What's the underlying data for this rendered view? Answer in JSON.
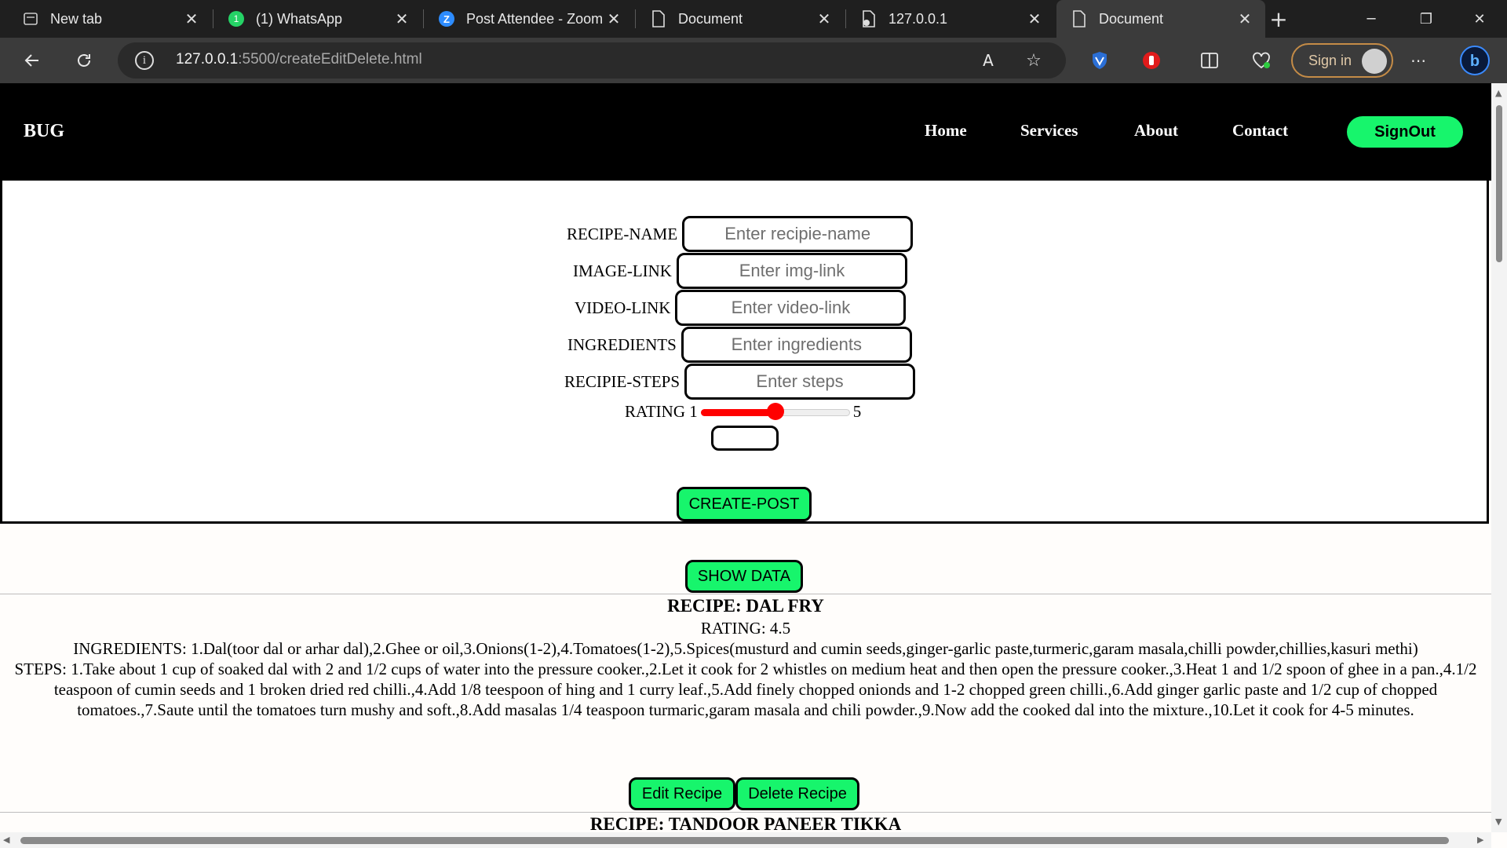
{
  "browser": {
    "tabs": [
      {
        "title": "New tab",
        "icon": "new-tab-icon",
        "active": false
      },
      {
        "title": "(1) WhatsApp",
        "icon": "whatsapp-icon",
        "active": false
      },
      {
        "title": "Post Attendee - Zoom",
        "icon": "zoom-icon",
        "active": false
      },
      {
        "title": "Document",
        "icon": "document-icon",
        "active": false
      },
      {
        "title": "127.0.0.1",
        "icon": "page-icon",
        "active": false
      },
      {
        "title": "Document",
        "icon": "document-icon",
        "active": true
      }
    ],
    "url_host": "127.0.0.1",
    "url_path": ":5500/createEditDelete.html",
    "signin_label": "Sign in"
  },
  "nav": {
    "brand": "BUG",
    "links": [
      "Home",
      "Services",
      "About",
      "Contact"
    ],
    "signout_label": "SignOut"
  },
  "form": {
    "recipe_name_label": "RECIPE-NAME",
    "recipe_name_placeholder": "Enter recipie-name",
    "image_link_label": "IMAGE-LINK",
    "image_link_placeholder": "Enter img-link",
    "video_link_label": "VIDEO-LINK",
    "video_link_placeholder": "Enter video-link",
    "ingredients_label": "INGREDIENTS",
    "ingredients_placeholder": "Enter ingredients",
    "steps_label": "RECIPIE-STEPS",
    "steps_placeholder": "Enter steps",
    "rating_label": "RATING",
    "rating_min": "1",
    "rating_max": "5",
    "rating_value": 3,
    "slider_color": "#ff0000",
    "create_label": "CREATE-POST"
  },
  "show_data_label": "SHOW DATA",
  "recipes": [
    {
      "title": "RECIPE: DAL FRY",
      "rating": "RATING: 4.5",
      "ingredients": "INGREDIENTS: 1.Dal(toor dal or arhar dal),2.Ghee or oil,3.Onions(1-2),4.Tomatoes(1-2),5.Spices(musturd and cumin seeds,ginger-garlic paste,turmeric,garam masala,chilli powder,chillies,kasuri methi)",
      "steps": "STEPS: 1.Take about 1 cup of soaked dal with 2 and 1/2 cups of water into the pressure cooker.,2.Let it cook for 2 whistles on medium heat and then open the pressure cooker.,3.Heat 1 and 1/2 spoon of ghee in a pan.,4.1/2 teaspoon of cumin seeds and 1 broken dried red chilli.,4.Add 1/8 teespoon of hing and 1 curry leaf.,5.Add finely chopped onionds and 1-2 chopped green chilli.,6.Add ginger garlic paste and 1/2 cup of chopped tomatoes.,7.Saute until the tomatoes turn mushy and soft.,8.Add masalas 1/4 teaspoon turmaric,garam masala and chili powder.,9.Now add the cooked dal into the mixture.,10.Let it cook for 4-5 minutes.",
      "edit_label": "Edit Recipe",
      "delete_label": "Delete Recipe"
    },
    {
      "title": "RECIPE: TANDOOR PANEER TIKKA"
    }
  ],
  "colors": {
    "accent": "#17f56c",
    "navbar": "#000000"
  }
}
